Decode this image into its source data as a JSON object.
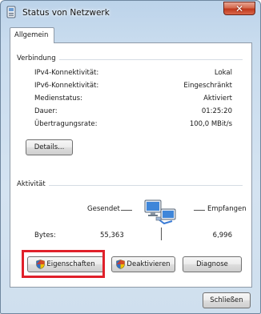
{
  "window": {
    "title": "Status von Netzwerk",
    "close_label": "✕"
  },
  "tabs": [
    {
      "label": "Allgemein"
    }
  ],
  "connection": {
    "group_label": "Verbindung",
    "rows": [
      {
        "label": "IPv4-Konnektivität:",
        "value": "Lokal"
      },
      {
        "label": "IPv6-Konnektivität:",
        "value": "Eingeschränkt"
      },
      {
        "label": "Medienstatus:",
        "value": "Aktiviert"
      },
      {
        "label": "Dauer:",
        "value": "01:25:20"
      },
      {
        "label": "Übertragungsrate:",
        "value": "100,0 MBit/s"
      }
    ],
    "details_button": "Details..."
  },
  "activity": {
    "group_label": "Aktivität",
    "sent_label": "Gesendet",
    "received_label": "Empfangen",
    "bytes_label": "Bytes:",
    "bytes_sent": "55,363",
    "bytes_received": "6,996"
  },
  "buttons": {
    "properties": "Eigenschaften",
    "deactivate": "Deaktivieren",
    "diagnose": "Diagnose",
    "close": "Schließen"
  },
  "icons": {
    "title": "network-connection-icon",
    "shield": "uac-shield-icon",
    "network": "network-activity-icon"
  },
  "colors": {
    "highlight": "#e0202a",
    "close_button": "#c0391d"
  }
}
